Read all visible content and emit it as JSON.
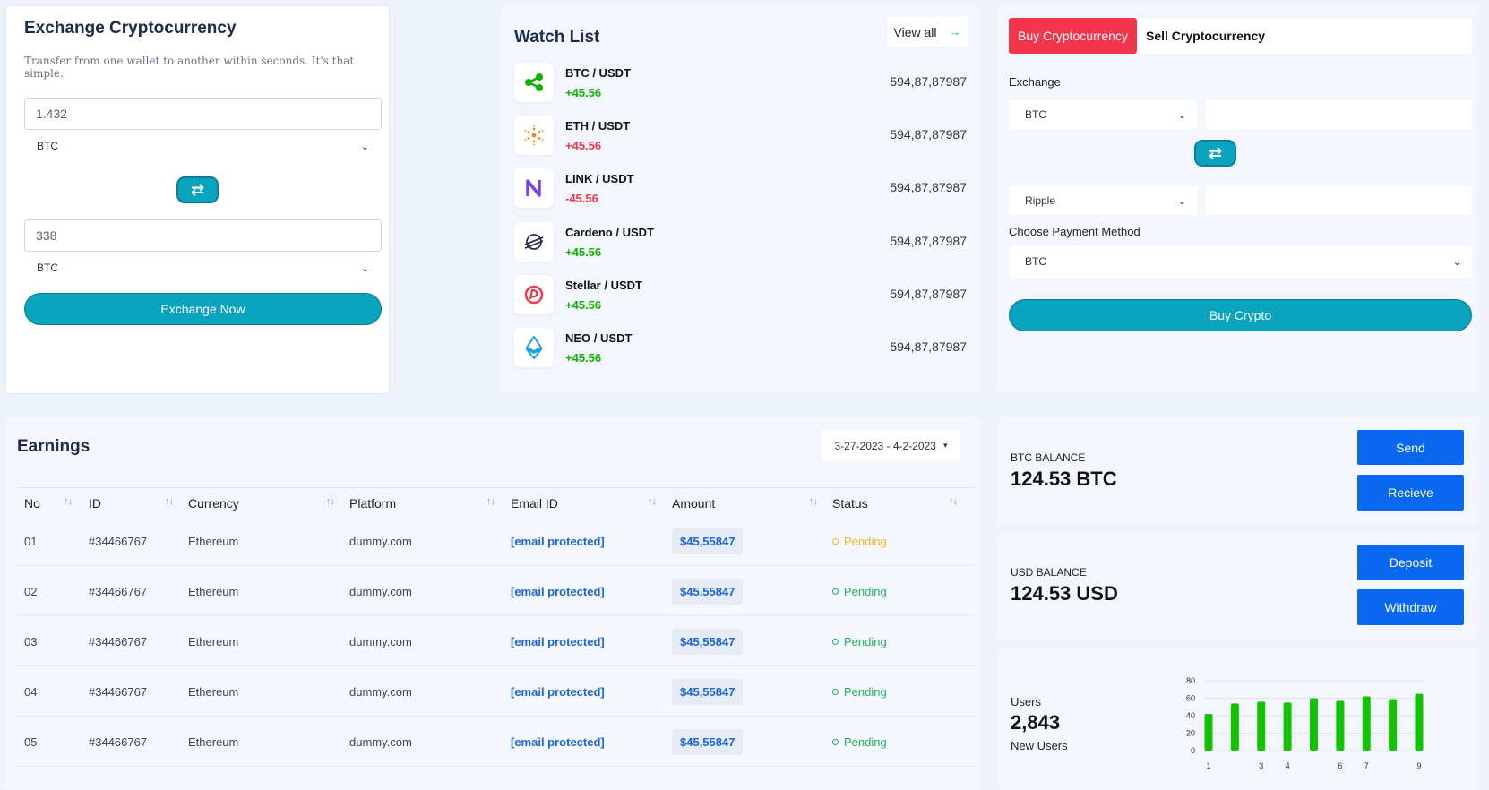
{
  "exchange": {
    "title": "Exchange Cryptocurrency",
    "subtitle": "Transfer from one wallet to another within seconds. It's that simple.",
    "amount_from": "1.432",
    "currency_from": "BTC",
    "amount_to": "338",
    "currency_to": "BTC",
    "swap_icon": "⇄",
    "submit_label": "Exchange Now"
  },
  "watchlist": {
    "title": "Watch List",
    "view_all": "View all",
    "view_all_icon": "→",
    "items": [
      {
        "pair": "BTC / USDT",
        "change": "+45.56",
        "direction": "up",
        "value": "594,87,87987",
        "icon": "ripple-icon"
      },
      {
        "pair": "ETH / USDT",
        "change": "+45.56",
        "direction": "down-color",
        "value": "594,87,87987",
        "icon": "cardano-icon"
      },
      {
        "pair": "LINK / USDT",
        "change": "-45.56",
        "direction": "down",
        "value": "594,87,87987",
        "icon": "n-logo-icon"
      },
      {
        "pair": "Cardeno / USDT",
        "change": "+45.56",
        "direction": "up",
        "value": "594,87,87987",
        "icon": "stellar-icon"
      },
      {
        "pair": "Stellar / USDT",
        "change": "+45.56",
        "direction": "up",
        "value": "594,87,87987",
        "icon": "circle-logo-icon"
      },
      {
        "pair": "NEO / USDT",
        "change": "+45.56",
        "direction": "up",
        "value": "594,87,87987",
        "icon": "ethereum-icon"
      }
    ]
  },
  "buysell": {
    "tab_buy": "Buy Cryptocurrency",
    "tab_sell": "Sell Cryptocurrency",
    "exchange_label": "Exchange",
    "from_currency": "BTC",
    "to_currency": "Ripple",
    "swap_icon": "⇄",
    "payment_label": "Choose Payment Method",
    "payment_method": "BTC",
    "submit_label": "Buy Crypto"
  },
  "earnings": {
    "title": "Earnings",
    "date_range": "3-27-2023 - 4-2-2023",
    "columns": [
      "No",
      "ID",
      "Currency",
      "Platform",
      "Email ID",
      "Amount",
      "Status"
    ],
    "rows": [
      {
        "no": "01",
        "id": "#34466767",
        "currency": "Ethereum",
        "platform": "dummy.com",
        "email": "[email protected]",
        "amount": "$45,55847",
        "status": "Pending",
        "status_color": "#f3b61c"
      },
      {
        "no": "02",
        "id": "#34466767",
        "currency": "Ethereum",
        "platform": "dummy.com",
        "email": "[email protected]",
        "amount": "$45,55847",
        "status": "Pending",
        "status_color": "#22b45a"
      },
      {
        "no": "03",
        "id": "#34466767",
        "currency": "Ethereum",
        "platform": "dummy.com",
        "email": "[email protected]",
        "amount": "$45,55847",
        "status": "Pending",
        "status_color": "#22b45a"
      },
      {
        "no": "04",
        "id": "#34466767",
        "currency": "Ethereum",
        "platform": "dummy.com",
        "email": "[email protected]",
        "amount": "$45,55847",
        "status": "Pending",
        "status_color": "#22b45a"
      },
      {
        "no": "05",
        "id": "#34466767",
        "currency": "Ethereum",
        "platform": "dummy.com",
        "email": "[email protected]",
        "amount": "$45,55847",
        "status": "Pending",
        "status_color": "#22b45a"
      }
    ]
  },
  "btc_balance": {
    "label": "BTC BALANCE",
    "value": "124.53 BTC",
    "btn1": "Send",
    "btn2": "Recieve"
  },
  "usd_balance": {
    "label": "USD BALANCE",
    "value": "124.53 USD",
    "btn1": "Deposit",
    "btn2": "Withdraw"
  },
  "users": {
    "label": "Users",
    "count": "2,843",
    "sublabel": "New Users"
  },
  "colors": {
    "accent": "#0aa4bf",
    "red": "#f4364c",
    "blue": "#0a68f0",
    "green": "#12b300"
  },
  "chart_data": {
    "type": "bar",
    "categories": [
      "1",
      "2",
      "3",
      "4",
      "5",
      "6",
      "7",
      "8",
      "9"
    ],
    "x_tick_labels": [
      "1",
      "3",
      "4",
      "6",
      "7",
      "9"
    ],
    "values": [
      42,
      54,
      56,
      55,
      60,
      57,
      62,
      59,
      65
    ],
    "ylim": [
      0,
      80
    ],
    "yticks": [
      0,
      20,
      40,
      60,
      80
    ],
    "grid": true,
    "color": "#12c400"
  }
}
